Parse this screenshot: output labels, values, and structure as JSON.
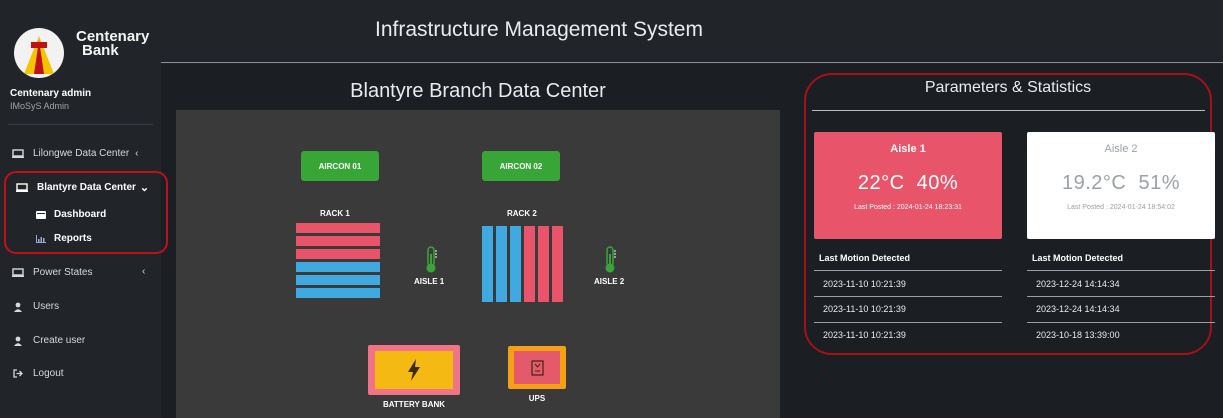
{
  "app": {
    "title": "Infrastructure Management System",
    "brand": [
      "Centenary",
      "Bank"
    ]
  },
  "user": {
    "name": "Centenary admin",
    "role": "IMoSyS Admin"
  },
  "sidebar": {
    "items": [
      {
        "label": "Lilongwe Data Center",
        "icon": "monitor-icon",
        "chevron": "‹"
      },
      {
        "label": "Blantyre Data Center",
        "icon": "monitor-icon",
        "chevron": "⌄"
      },
      {
        "label": "Power States",
        "icon": "monitor-icon",
        "chevron": "‹"
      },
      {
        "label": "Users",
        "icon": "user-icon"
      },
      {
        "label": "Create user",
        "icon": "user-icon"
      },
      {
        "label": "Logout",
        "icon": "logout-icon"
      }
    ],
    "subitems": [
      {
        "label": "Dashboard",
        "icon": "dashboard-icon"
      },
      {
        "label": "Reports",
        "icon": "chart-icon"
      }
    ]
  },
  "datacenter": {
    "title": "Blantyre Branch Data Center",
    "aircons": [
      "AIRCON 01",
      "AIRCON 02"
    ],
    "racks": [
      "RACK 1",
      "RACK 2"
    ],
    "aisles": [
      "AISLE 1",
      "AISLE 2"
    ],
    "battery_label": "BATTERY BANK",
    "ups_label": "UPS"
  },
  "stats": {
    "title": "Parameters & Statistics",
    "aisles": [
      {
        "name": "Aisle 1",
        "temp": "22°C",
        "humidity": "40%",
        "posted": "Last Posted : 2024-01-24 18:23:31"
      },
      {
        "name": "Aisle 2",
        "temp": "19.2°C",
        "humidity": "51%",
        "posted": "Last Posted : 2024-01-24 18:54:02"
      }
    ],
    "motion_header": "Last Motion Detected",
    "motion": [
      [
        "2023-11-10 10:21:39",
        "2023-11-10 10:21:39",
        "2023-11-10 10:21:39"
      ],
      [
        "2023-12-24 14:14:34",
        "2023-12-24 14:14:34",
        "2023-10-18 13:39:00"
      ]
    ]
  },
  "colors": {
    "accent_red": "#a3111b",
    "aisle1_card": "#e8546a",
    "aircon": "#37a637",
    "rack_red": "#e8546a",
    "rack_blue": "#3fa9e0"
  }
}
